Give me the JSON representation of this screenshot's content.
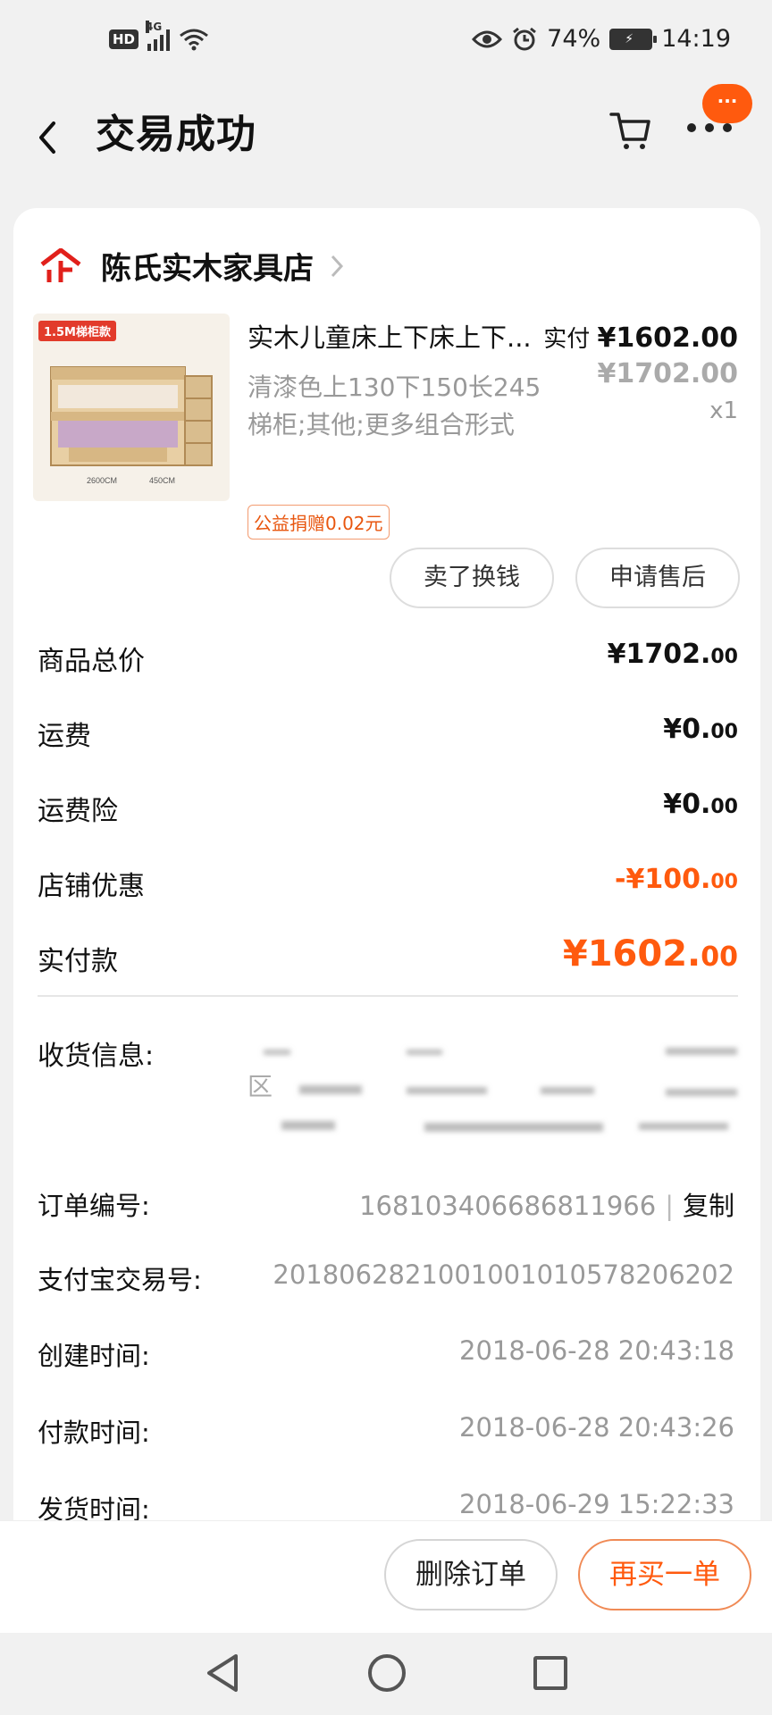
{
  "status_bar": {
    "hd": "HD",
    "network": "4G",
    "battery_percent": "74%",
    "time": "14:19"
  },
  "header": {
    "title": "交易成功",
    "badge": "···"
  },
  "shop": {
    "name": "陈氏实木家具店"
  },
  "product": {
    "thumb_tag": "1.5M梯柜款",
    "title": "实木儿童床上下床上下...",
    "spec": "清漆色上130下150长245梯柜;其他;更多组合形式",
    "charity": "公益捐赠0.02元",
    "paid_label": "实付",
    "paid_price": "¥1602.00",
    "original_price": "¥1702.00",
    "quantity": "x1"
  },
  "actions": {
    "sell": "卖了换钱",
    "after_sale": "申请售后"
  },
  "summary": [
    {
      "label": "商品总价",
      "value": "¥1702.",
      "decimals": "00"
    },
    {
      "label": "运费",
      "value": "¥0.",
      "decimals": "00"
    },
    {
      "label": "运费险",
      "value": "¥0.",
      "decimals": "00"
    },
    {
      "label": "店铺优惠",
      "value": "-¥100.",
      "decimals": "00"
    },
    {
      "label": "实付款",
      "value": "¥1602.",
      "decimals": "00"
    }
  ],
  "address": {
    "label": "收货信息:",
    "visible_text": "区"
  },
  "order_info": {
    "order_no_label": "订单编号:",
    "order_no": "168103406686811966",
    "separator": "|",
    "copy": "复制",
    "alipay_label": "支付宝交易号:",
    "alipay_no": "2018062821001001010578206202",
    "created_label": "创建时间:",
    "created": "2018-06-28 20:43:18",
    "paid_label": "付款时间:",
    "paid": "2018-06-28 20:43:26",
    "shipped_label": "发货时间:",
    "shipped": "2018-06-29 15:22:33"
  },
  "bottom": {
    "delete": "删除订单",
    "rebuy": "再买一单"
  },
  "colors": {
    "accent": "#ff5a0e",
    "shop_logo": "#e1201b"
  }
}
